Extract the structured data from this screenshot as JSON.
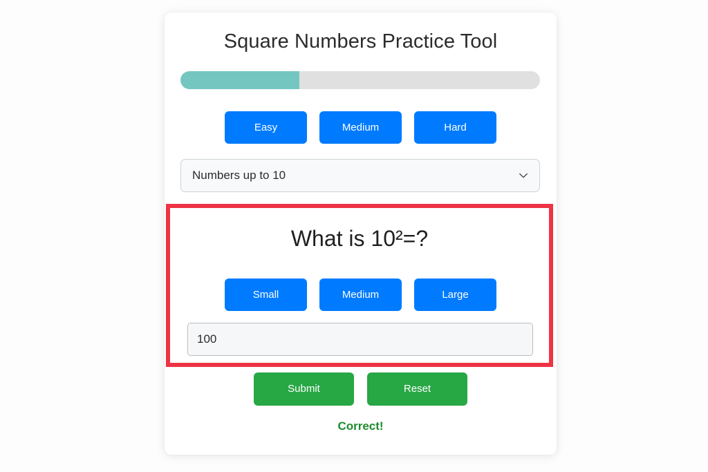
{
  "app": {
    "title": "Square Numbers Practice Tool",
    "background_color": "#fdfdfd",
    "card_background": "#ffffff"
  },
  "progress": {
    "percent": 33,
    "fill_color": "#74c6c1",
    "track_color": "#e0e0e0"
  },
  "difficulty_buttons": [
    {
      "label": "Easy",
      "color": "#007bff"
    },
    {
      "label": "Medium",
      "color": "#007bff"
    },
    {
      "label": "Hard",
      "color": "#007bff"
    }
  ],
  "range_select": {
    "selected": "Numbers up to 10",
    "icon": "chevron-down-icon"
  },
  "question_panel": {
    "highlight_color": "#ee3344",
    "question": "What is 10²=?",
    "size_buttons": [
      {
        "label": "Small",
        "color": "#007bff"
      },
      {
        "label": "Medium",
        "color": "#007bff"
      },
      {
        "label": "Large",
        "color": "#007bff"
      }
    ],
    "answer_input": {
      "value": "100",
      "placeholder": ""
    }
  },
  "actions": [
    {
      "label": "Submit",
      "color": "#28a745"
    },
    {
      "label": "Reset",
      "color": "#28a745"
    }
  ],
  "feedback": {
    "text": "Correct!",
    "color": "#1e8a2e"
  }
}
